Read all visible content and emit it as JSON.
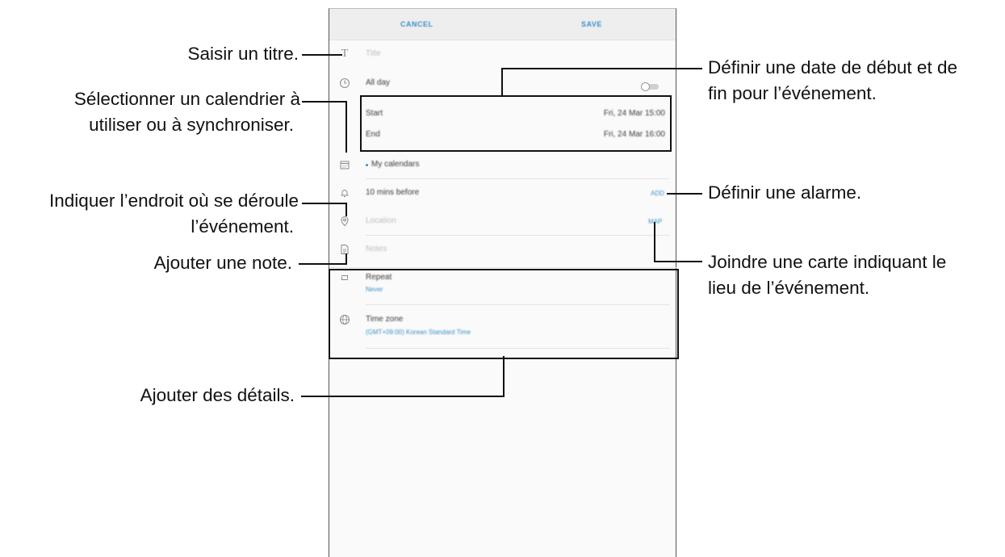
{
  "topbar": {
    "cancel_label": "CANCEL",
    "save_label": "SAVE"
  },
  "form": {
    "title_placeholder": "Title",
    "all_day_label": "All day",
    "start_label": "Start",
    "start_value": "Fri, 24 Mar   15:00",
    "end_label": "End",
    "end_value": "Fri, 24 Mar   16:00",
    "calendar_label": "My calendars",
    "reminder_label": "10 mins before",
    "reminder_add": "ADD",
    "location_placeholder": "Location",
    "map_label": "MAP",
    "notes_placeholder": "Notes",
    "repeat_label": "Repeat",
    "repeat_value": "Never",
    "timezone_label": "Time zone",
    "timezone_value": "(GMT+09:00) Korean Standard Time"
  },
  "callouts": {
    "title": "Saisir un titre.",
    "calendar_line1": "Sélectionner un calendrier à",
    "calendar_line2": "utiliser ou à synchroniser.",
    "location_line1": "Indiquer l’endroit où se déroule",
    "location_line2": "l’événement.",
    "note": "Ajouter une note.",
    "details": "Ajouter des détails.",
    "dates_line1": "Définir une date de début et de",
    "dates_line2": "fin pour l’événement.",
    "alarm": "Définir une alarme.",
    "map_line1": "Joindre une carte indiquant le",
    "map_line2": "lieu de l’événement."
  },
  "colors": {
    "accent": "#3e91c9",
    "callout_line": "#111111",
    "topbar_bg": "#eeeeee"
  },
  "icons": [
    "text-icon",
    "clock-icon",
    "calendar-icon",
    "bell-icon",
    "location-pin-icon",
    "note-icon",
    "repeat-icon",
    "globe-icon"
  ]
}
